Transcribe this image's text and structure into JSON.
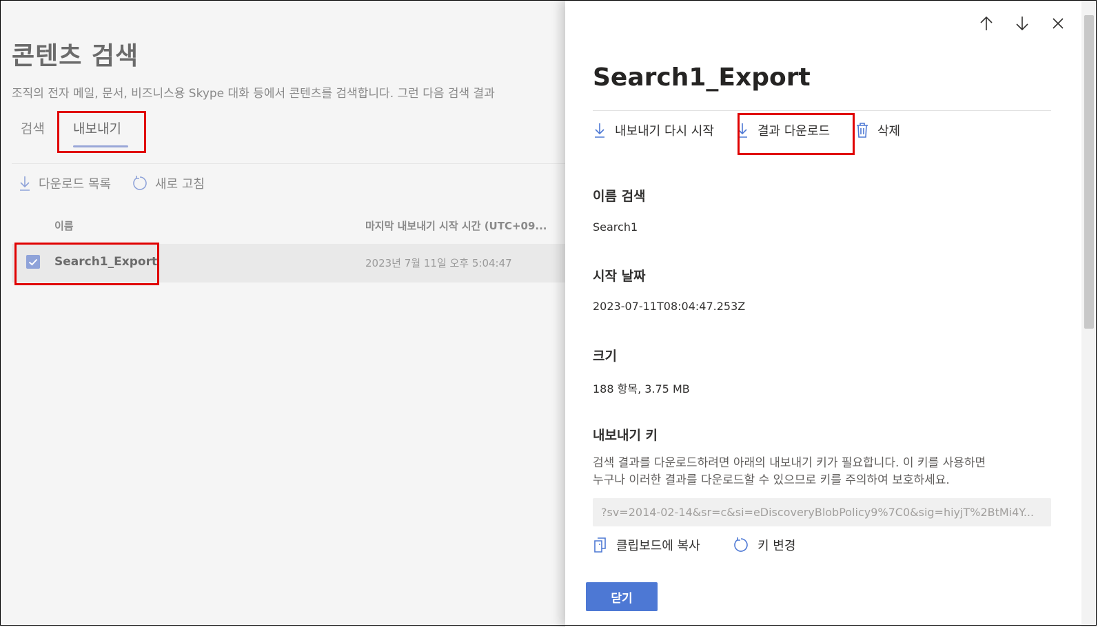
{
  "page": {
    "title": "콘텐츠 검색",
    "description": "조직의 전자 메일, 문서, 비즈니스용 Skype 대화 등에서 콘텐츠를 검색합니다. 그런 다음 검색 결과"
  },
  "tabs": [
    {
      "label": "검색",
      "selected": false
    },
    {
      "label": "내보내기",
      "selected": true
    }
  ],
  "toolbar": {
    "download_list_label": "다운로드 목록",
    "refresh_label": "새로 고침"
  },
  "table": {
    "columns": [
      "이름",
      "마지막 내보내기 시작 시간 (UTC+09..."
    ],
    "rows": [
      {
        "name": "Search1_Export",
        "date": "2023년 7월 11일 오후 5:04:47",
        "checked": true
      }
    ]
  },
  "panel": {
    "title": "Search1_Export",
    "commands": {
      "restart_label": "내보내기 다시 시작",
      "download_label": "결과 다운로드",
      "delete_label": "삭제"
    },
    "fields": {
      "search_name_label": "이름 검색",
      "search_name_value": "Search1",
      "start_date_label": "시작 날짜",
      "start_date_value": "2023-07-11T08:04:47.253Z",
      "size_label": "크기",
      "size_value": "188 항목, 3.75 MB",
      "export_key_label": "내보내기 키"
    },
    "export_key": {
      "desc_line1": "검색 결과를 다운로드하려면 아래의 내보내기 키가 필요합니다. 이 키를 사용하면",
      "desc_line2": "누구나 이러한 결과를 다운로드할 수 있으므로 키를 주의하여 보호하세요.",
      "value": "?sv=2014-02-14&sr=c&si=eDiscoveryBlobPolicy9%7C0&sig=hiyjT%2BtMi4Y...",
      "copy_label": "클립보드에 복사",
      "change_key_label": "키 변경"
    },
    "close_label": "닫기"
  },
  "colors": {
    "accent": "#4d78d4",
    "highlight_box": "#e00000",
    "checkbox": "#8fa3d9"
  },
  "icons": [
    "arrow-up-icon",
    "arrow-down-icon",
    "close-icon",
    "download-icon",
    "refresh-icon",
    "trash-icon",
    "copy-icon",
    "checkmark-icon"
  ]
}
